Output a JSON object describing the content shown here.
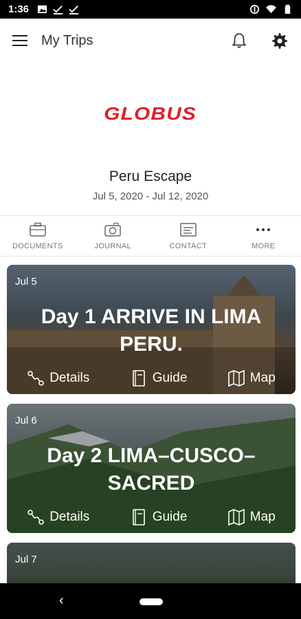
{
  "status": {
    "time": "1:36"
  },
  "app_bar": {
    "title": "My Trips"
  },
  "logo": {
    "text": "GLOBUS",
    "brand_color": "#e01e2b"
  },
  "trip": {
    "title": "Peru Escape",
    "dates": "Jul 5, 2020 - Jul 12, 2020"
  },
  "tabs": [
    {
      "label": "DOCUMENTS",
      "icon": "briefcase-icon"
    },
    {
      "label": "JOURNAL",
      "icon": "camera-icon"
    },
    {
      "label": "CONTACT",
      "icon": "contact-card-icon"
    },
    {
      "label": "MORE",
      "icon": "more-dots-icon"
    }
  ],
  "cards": [
    {
      "date": "Jul 5",
      "title": "Day 1 ARRIVE IN LIMA PERU.",
      "actions": {
        "details": "Details",
        "guide": "Guide",
        "map": "Map"
      }
    },
    {
      "date": "Jul 6",
      "title": "Day 2 LIMA–CUSCO–SACRED",
      "actions": {
        "details": "Details",
        "guide": "Guide",
        "map": "Map"
      }
    },
    {
      "date": "Jul 7"
    }
  ]
}
